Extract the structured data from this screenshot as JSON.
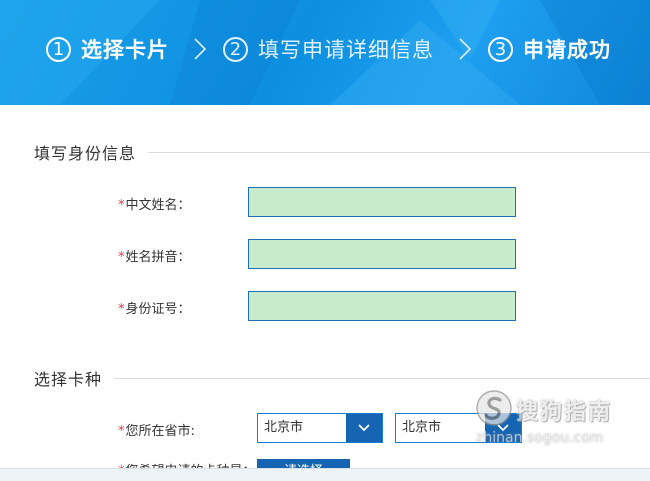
{
  "steps": [
    {
      "num": "1",
      "label": "选择卡片",
      "active": true
    },
    {
      "num": "2",
      "label": "填写申请详细信息",
      "active": false
    },
    {
      "num": "3",
      "label": "申请成功",
      "active": true
    }
  ],
  "section_identity": "填写身份信息",
  "fields": {
    "chinese_name": {
      "required": "*",
      "label": "中文姓名：",
      "value": ""
    },
    "pinyin_name": {
      "required": "*",
      "label": "姓名拼音：",
      "value": ""
    },
    "id_number": {
      "required": "*",
      "label": "身份证号：",
      "value": ""
    }
  },
  "section_card": "选择卡种",
  "location": {
    "required": "*",
    "label": "您所在省市:",
    "province": "北京市",
    "city": "北京市"
  },
  "card_type": {
    "required": "*",
    "label": "您希望申请的卡种是：",
    "button": "请选择"
  },
  "watermark": {
    "text": "搜狗指南",
    "sub": "zhinan.sogou.com"
  },
  "colors": {
    "banner": "#0d8fe0",
    "input_fill": "#c7ebcb",
    "input_border": "#1e6fb8",
    "select_button": "#1565b3",
    "required": "#e4393c"
  },
  "icons": {
    "step_separator": "chevron-right-icon",
    "select_arrow": "chevron-down-icon"
  }
}
